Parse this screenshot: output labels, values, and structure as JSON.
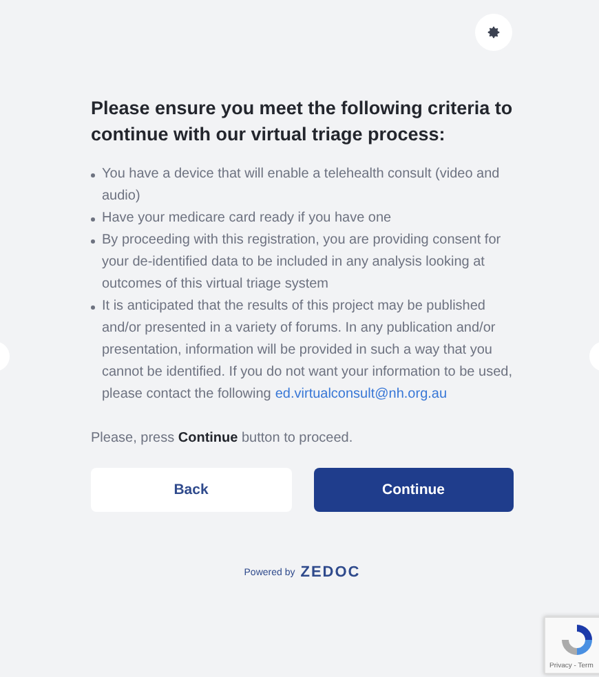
{
  "heading": "Please ensure you meet the following criteria to continue with our virtual triage process:",
  "criteria": [
    {
      "text": "You have a device that will enable a telehealth consult (video and audio)"
    },
    {
      "text": "Have your medicare card ready if you have one"
    },
    {
      "text": "By proceeding with this registration, you are providing consent for your de-identified data to be included in any analysis looking at outcomes of this virtual triage system"
    },
    {
      "text": "It is anticipated that the results of this project may be published and/or presented in a variety of forums. In any publication and/or presentation, information will be provided in such a way that you cannot be identified. If you do not want your information to be used, please contact the following",
      "link": "ed.virtualconsult@nh.org.au"
    }
  ],
  "instruction": "Please, press **Continue** button to proceed.",
  "buttons": [
    {
      "label": "Back",
      "kind": "secondary"
    },
    {
      "label": "Continue",
      "kind": "primary"
    }
  ],
  "footer": {
    "powered_by": "Powered by",
    "brand": "ZEDOC"
  },
  "recaptcha": {
    "links": "Privacy - Term"
  }
}
